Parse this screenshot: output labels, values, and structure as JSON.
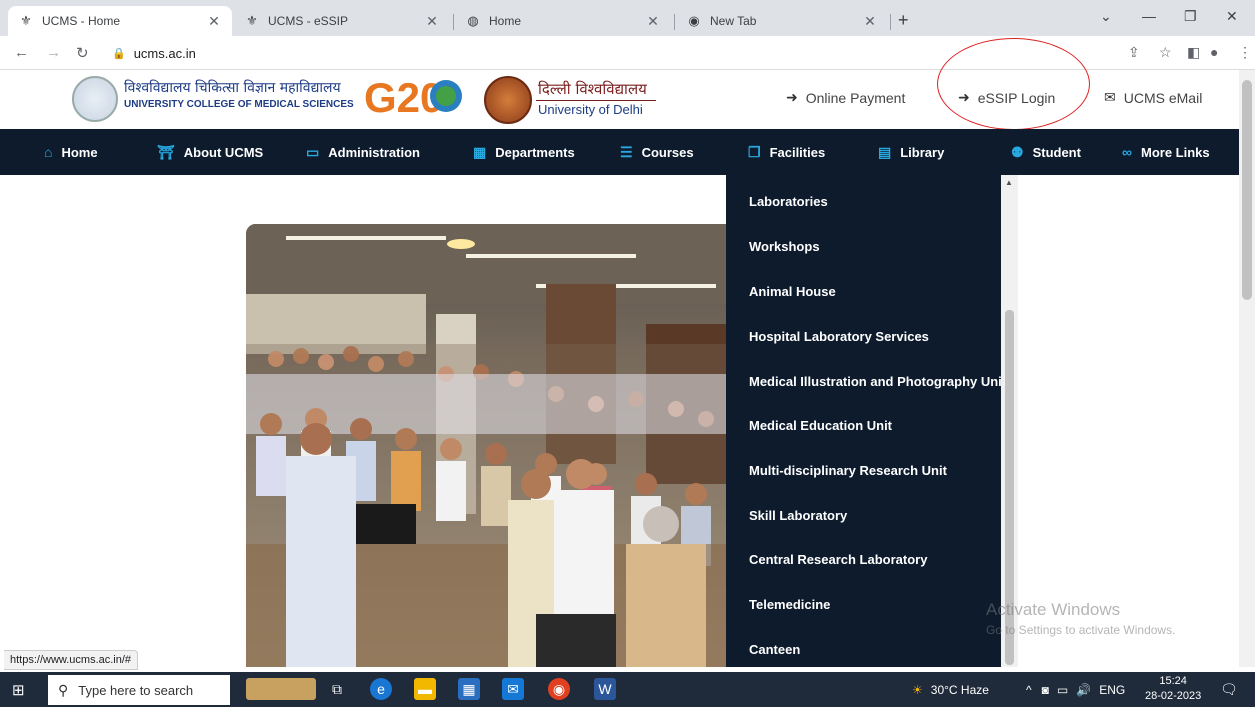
{
  "browser": {
    "tabs": [
      {
        "title": "UCMS - Home",
        "favicon": "ucms-emblem",
        "active": true
      },
      {
        "title": "UCMS - eSSIP",
        "favicon": "ucms-emblem",
        "active": false
      },
      {
        "title": "Home",
        "favicon": "globe",
        "active": false
      },
      {
        "title": "New Tab",
        "favicon": "chrome",
        "active": false
      }
    ],
    "url": "ucms.ac.in",
    "status_url": "https://www.ucms.ac.in/#"
  },
  "header": {
    "college_hindi": "विश्वविद्यालय चिकित्सा विज्ञान महाविद्यालय",
    "college_english": "UNIVERSITY COLLEGE OF MEDICAL SCIENCES",
    "g20_text": "G20",
    "du_hindi": "दिल्ली विश्वविद्यालय",
    "du_english": "University of Delhi",
    "links": {
      "online_payment": "Online Payment",
      "essip_login": "eSSIP Login",
      "ucms_email": "UCMS eMail"
    }
  },
  "nav": {
    "items": [
      {
        "label": "Home",
        "icon": "home-icon"
      },
      {
        "label": "About UCMS",
        "icon": "institution-icon"
      },
      {
        "label": "Administration",
        "icon": "desktop-icon"
      },
      {
        "label": "Departments",
        "icon": "building-icon"
      },
      {
        "label": "Courses",
        "icon": "list-icon"
      },
      {
        "label": "Facilities",
        "icon": "window-icon"
      },
      {
        "label": "Library",
        "icon": "book-icon"
      },
      {
        "label": "Student",
        "icon": "users-icon"
      },
      {
        "label": "More Links",
        "icon": "link-icon"
      }
    ]
  },
  "facilities_menu": [
    "Laboratories",
    "Workshops",
    "Animal House",
    "Hospital Laboratory Services",
    "Medical Illustration and Photography Unit",
    "Medical Education Unit",
    "Multi-disciplinary Research Unit",
    "Skill Laboratory",
    "Central Research Laboratory",
    "Telemedicine",
    "Canteen"
  ],
  "watermark": {
    "line1": "Activate Windows",
    "line2": "Go to Settings to activate Windows."
  },
  "taskbar": {
    "search_placeholder": "Type here to search",
    "weather": "30°C Haze",
    "language": "ENG",
    "time": "15:24",
    "date": "28-02-2023"
  }
}
